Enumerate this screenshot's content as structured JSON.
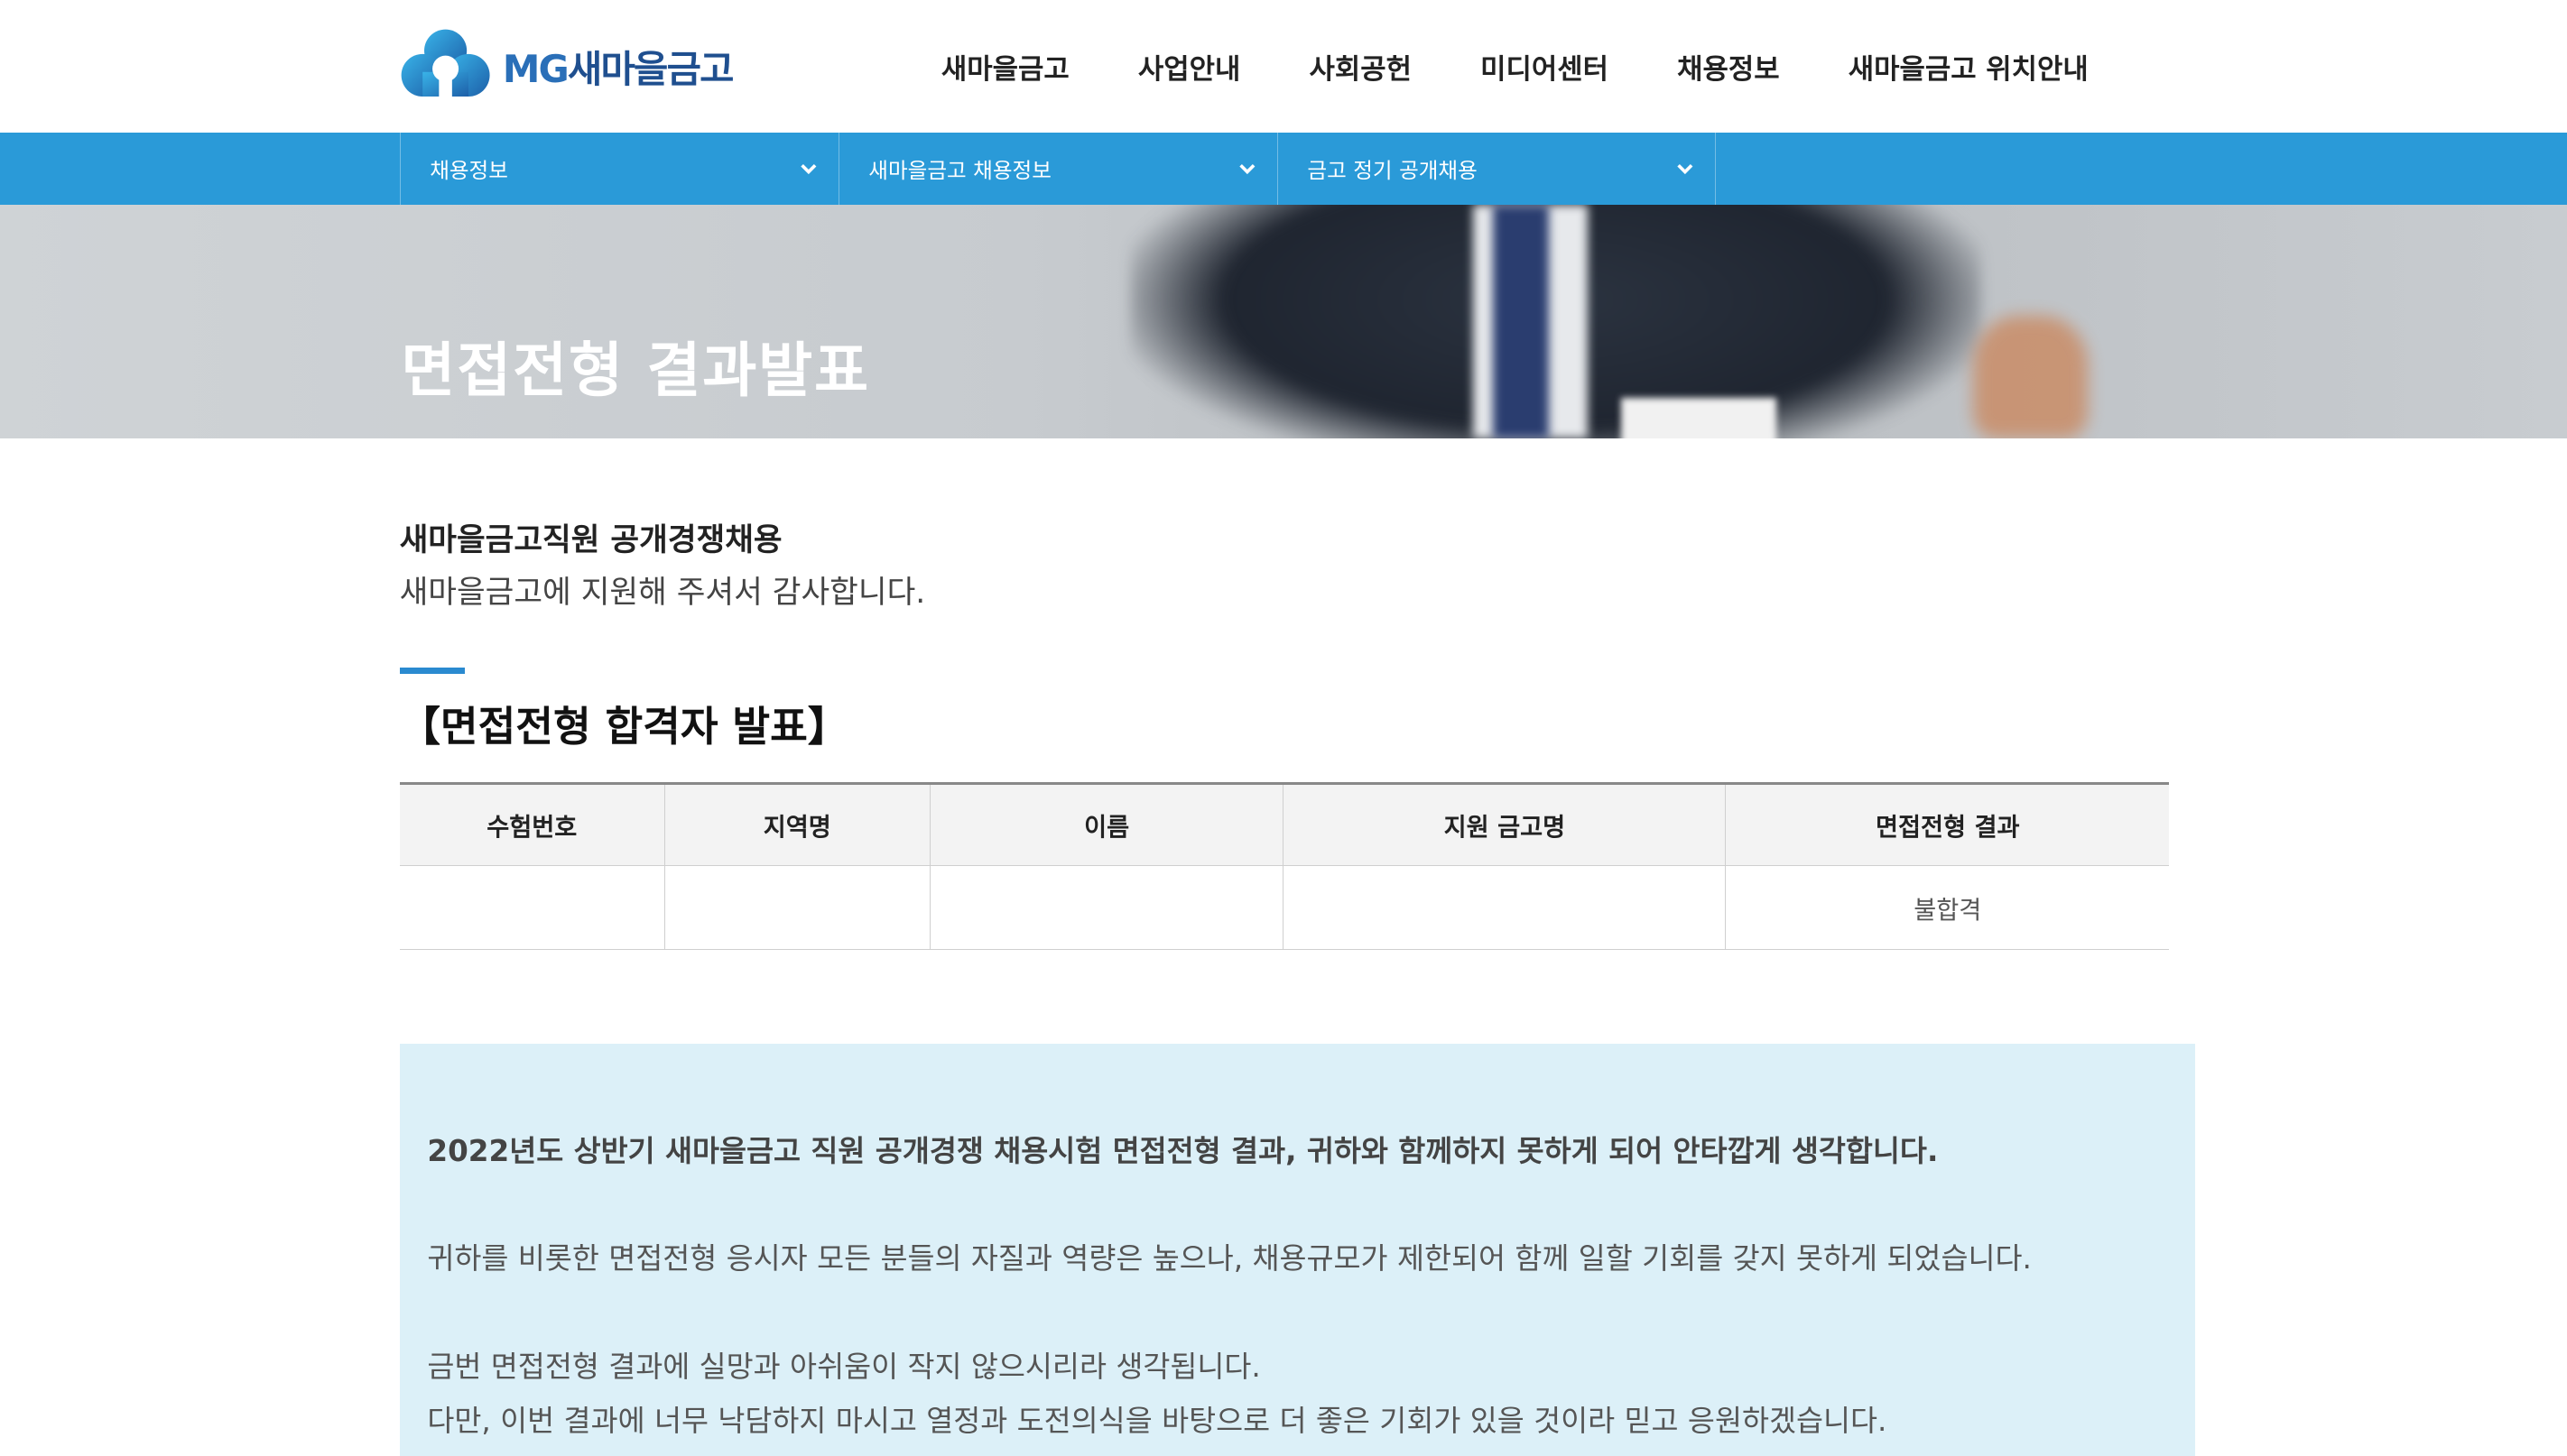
{
  "header": {
    "logo_text_mg": "MG",
    "logo_text_kr": "새마을금고",
    "nav": [
      "새마을금고",
      "사업안내",
      "사회공헌",
      "미디어센터",
      "채용정보",
      "새마을금고 위치안내"
    ]
  },
  "subnav": {
    "items": [
      "채용정보",
      "새마을금고 채용정보",
      "금고 정기 공개채용"
    ]
  },
  "hero": {
    "title": "면접전형 결과발표"
  },
  "intro": {
    "line1": "새마을금고직원 공개경쟁채용",
    "line2": "새마을금고에 지원해 주셔서 감사합니다."
  },
  "section": {
    "title": "【면접전형 합격자 발표】"
  },
  "table": {
    "headers": [
      "수험번호",
      "지역명",
      "이름",
      "지원 금고명",
      "면접전형 결과"
    ],
    "rows": [
      [
        "",
        "",
        "",
        "",
        "불합격"
      ]
    ]
  },
  "notice": {
    "p1": "2022년도 상반기 새마을금고 직원 공개경쟁 채용시험 면접전형 결과, 귀하와 함께하지 못하게 되어 안타깝게 생각합니다.",
    "p2": "귀하를 비롯한 면접전형 응시자 모든 분들의 자질과 역량은 높으나, 채용규모가 제한되어 함께 일할 기회를 갖지 못하게 되었습니다.",
    "p3": "금번 면접전형 결과에 실망과 아쉬움이 작지 않으시리라 생각됩니다.",
    "p4": "다만, 이번 결과에 너무 낙담하지 마시고 열정과 도전의식을 바탕으로 더 좋은 기회가 있을 것이라 믿고 응원하겠습니다."
  },
  "colors": {
    "brand_blue": "#2a9ad8",
    "notice_bg": "#dcf0f8",
    "logo_navy": "#1f4f8f"
  }
}
